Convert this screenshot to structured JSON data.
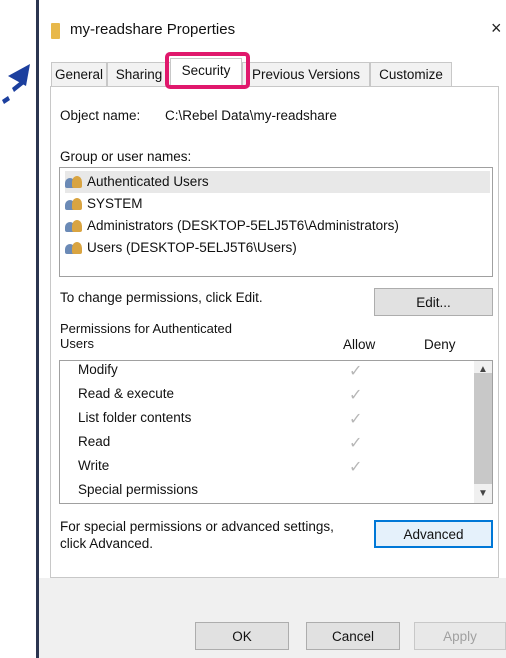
{
  "window": {
    "title": "my-readshare Properties",
    "close_glyph": "×"
  },
  "tabs": [
    {
      "label": "General"
    },
    {
      "label": "Sharing"
    },
    {
      "label": "Security"
    },
    {
      "label": "Previous Versions"
    },
    {
      "label": "Customize"
    }
  ],
  "active_tab": "Security",
  "object_name": {
    "label": "Object name:",
    "value": "C:\\Rebel Data\\my-readshare"
  },
  "group_users": {
    "label": "Group or user names:",
    "items": [
      {
        "name": "Authenticated Users"
      },
      {
        "name": "SYSTEM"
      },
      {
        "name": "Administrators (DESKTOP-5ELJ5T6\\Administrators)"
      },
      {
        "name": "Users (DESKTOP-5ELJ5T6\\Users)"
      }
    ]
  },
  "change_permissions": {
    "text": "To change permissions, click Edit.",
    "edit_button": "Edit..."
  },
  "permissions": {
    "header_line1": "Permissions for Authenticated",
    "header_line2": "Users",
    "allow_label": "Allow",
    "deny_label": "Deny",
    "rows": [
      {
        "name": "Modify",
        "allow": true
      },
      {
        "name": "Read & execute",
        "allow": true
      },
      {
        "name": "List folder contents",
        "allow": true
      },
      {
        "name": "Read",
        "allow": true
      },
      {
        "name": "Write",
        "allow": true
      },
      {
        "name": "Special permissions",
        "allow": false
      }
    ],
    "check_glyph": "✓",
    "scroll_up_glyph": "▲",
    "scroll_down_glyph": "▼"
  },
  "advanced": {
    "text_line1": "For special permissions or advanced settings,",
    "text_line2": "click Advanced.",
    "button": "Advanced"
  },
  "footer": {
    "ok": "OK",
    "cancel": "Cancel",
    "apply": "Apply"
  },
  "colors": {
    "highlight": "#e0186c",
    "accent": "#0078d7",
    "pointer_arrow": "#1c3f9e"
  }
}
